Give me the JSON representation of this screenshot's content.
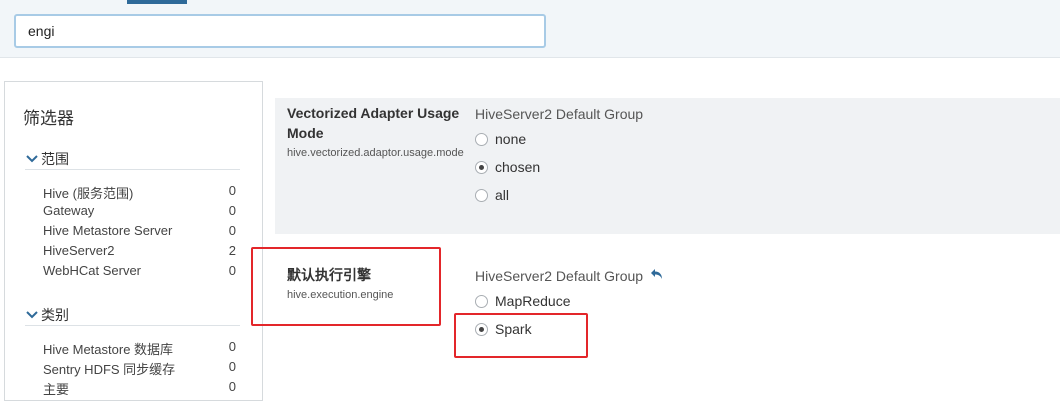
{
  "search": {
    "value": "engi"
  },
  "filters": {
    "title": "筛选器",
    "groups": [
      {
        "label": "范围",
        "items": [
          {
            "name": "Hive (服务范围)",
            "count": "0"
          },
          {
            "name": "Gateway",
            "count": "0"
          },
          {
            "name": "Hive Metastore Server",
            "count": "0"
          },
          {
            "name": "HiveServer2",
            "count": "2"
          },
          {
            "name": "WebHCat Server",
            "count": "0"
          }
        ]
      },
      {
        "label": "类别",
        "items": [
          {
            "name": "Hive Metastore 数据库",
            "count": "0"
          },
          {
            "name": "Sentry HDFS 同步缓存",
            "count": "0"
          },
          {
            "name": "主要",
            "count": "0"
          }
        ]
      }
    ]
  },
  "configs": [
    {
      "title": "Vectorized Adapter Usage Mode",
      "key": "hive.vectorized.adaptor.usage.mode",
      "group": "HiveServer2 Default Group",
      "options": [
        {
          "label": "none",
          "checked": false
        },
        {
          "label": "chosen",
          "checked": true
        },
        {
          "label": "all",
          "checked": false
        }
      ]
    },
    {
      "title": "默认执行引擎",
      "key": "hive.execution.engine",
      "group": "HiveServer2 Default Group",
      "options": [
        {
          "label": "MapReduce",
          "checked": false
        },
        {
          "label": "Spark",
          "checked": true
        }
      ]
    }
  ],
  "colors": {
    "accent": "#2f6a99",
    "highlight": "#e3262a",
    "search_border": "#a8cbe6"
  },
  "icons": {
    "group_chevron": "chevron-down-icon",
    "revert": "undo-icon"
  }
}
